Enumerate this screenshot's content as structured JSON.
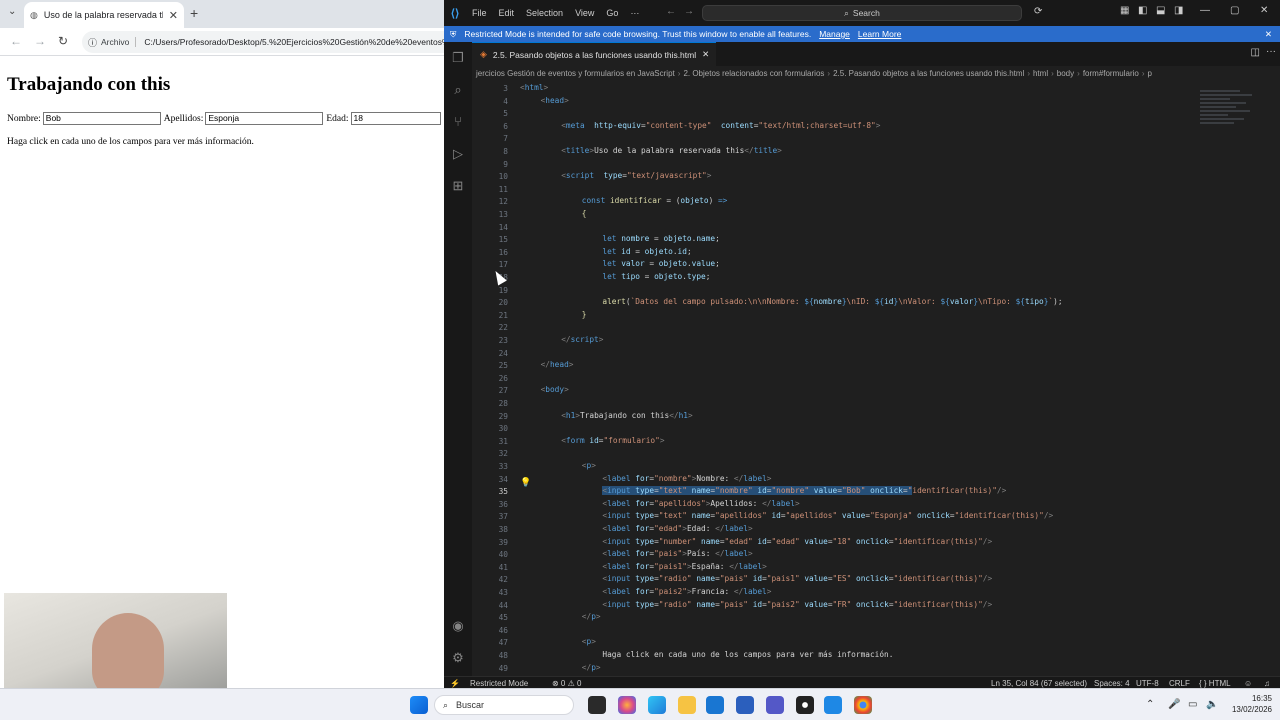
{
  "browser": {
    "tab_title": "Uso de la palabra reservada thi",
    "close": "✕",
    "new_tab": "+",
    "omnibox_chip": "Archivo",
    "url": "C:/Users/Profesorado/Desktop/5.%20Ejercicios%20Gestión%20de%20eventos%20y%20formularios",
    "page": {
      "heading": "Trabajando con this",
      "nombre_label": "Nombre:",
      "nombre_value": "Bob",
      "apellidos_label": "Apellidos:",
      "apellidos_value": "Esponja",
      "edad_label": "Edad:",
      "edad_value": "18",
      "info": "Haga click en cada uno de los campos para ver más información."
    }
  },
  "vscode": {
    "menu": [
      "File",
      "Edit",
      "Selection",
      "View",
      "Go",
      "···"
    ],
    "search_placeholder": "Search",
    "banner": {
      "text": "Restricted Mode is intended for safe code browsing. Trust this window to enable all features.",
      "manage": "Manage",
      "learn_more": "Learn More"
    },
    "active_tab": "2.5. Pasando objetos a las funciones usando this.html",
    "breadcrumb": [
      "jercicios Gestión de eventos y formularios en JavaScript",
      "2. Objetos relacionados con formularios",
      "2.5. Pasando objetos a las funciones usando this.html",
      "html",
      "body",
      "form#formulario",
      "p"
    ],
    "lines": [
      {
        "n": "3",
        "html": "<span class='tg'>&lt;</span><span class='tn'>html</span><span class='tg'>&gt;</span>",
        "indent": 0
      },
      {
        "n": "4",
        "html": "<span class='tg'>&lt;</span><span class='tn'>head</span><span class='tg'>&gt;</span>",
        "indent": 2
      },
      {
        "n": "5",
        "html": "",
        "indent": 0
      },
      {
        "n": "6",
        "html": "<span class='tg'>&lt;</span><span class='tn'>meta</span>  <span class='at'>http-equiv</span>=<span class='st'>\"content-type\"</span>  <span class='at'>content</span>=<span class='st'>\"text/html;charset=utf-8\"</span><span class='tg'>&gt;</span>",
        "indent": 4
      },
      {
        "n": "7",
        "html": "",
        "indent": 0
      },
      {
        "n": "8",
        "html": "<span class='tg'>&lt;</span><span class='tn'>title</span><span class='tg'>&gt;</span><span class='tx'>Uso de la palabra reservada this</span><span class='tg'>&lt;/</span><span class='tn'>title</span><span class='tg'>&gt;</span>",
        "indent": 4
      },
      {
        "n": "9",
        "html": "",
        "indent": 0
      },
      {
        "n": "10",
        "html": "<span class='tg'>&lt;</span><span class='tn'>script</span>  <span class='at'>type</span>=<span class='st'>\"text/javascript\"</span><span class='tg'>&gt;</span>",
        "indent": 4
      },
      {
        "n": "11",
        "html": "",
        "indent": 0
      },
      {
        "n": "12",
        "html": "<span class='kw'>const</span> <span class='fn'>identificar</span> = (<span class='at'>objeto</span>) <span class='kw'>=&gt;</span>",
        "indent": 6
      },
      {
        "n": "13",
        "html": "<span class='fn'>{</span>",
        "indent": 6
      },
      {
        "n": "14",
        "html": "",
        "indent": 0
      },
      {
        "n": "15",
        "html": "<span class='kw'>let</span> <span class='at'>nombre</span> = <span class='at'>objeto</span>.<span class='at'>name</span>;",
        "indent": 8
      },
      {
        "n": "16",
        "html": "<span class='kw'>let</span> <span class='at'>id</span> = <span class='at'>objeto</span>.<span class='at'>id</span>;",
        "indent": 8
      },
      {
        "n": "17",
        "html": "<span class='kw'>let</span> <span class='at'>valor</span> = <span class='at'>objeto</span>.<span class='at'>value</span>;",
        "indent": 8
      },
      {
        "n": "18",
        "html": "<span class='kw'>let</span> <span class='at'>tipo</span> = <span class='at'>objeto</span>.<span class='at'>type</span>;",
        "indent": 8
      },
      {
        "n": "19",
        "html": "",
        "indent": 0
      },
      {
        "n": "20",
        "html": "<span class='fn'>alert</span>(<span class='st'>`Datos del campo pulsado:\\n\\nNombre: </span><span class='kw'>${</span><span class='at'>nombre</span><span class='kw'>}</span><span class='st'>\\nID: </span><span class='kw'>${</span><span class='at'>id</span><span class='kw'>}</span><span class='st'>\\nValor: </span><span class='kw'>${</span><span class='at'>valor</span><span class='kw'>}</span><span class='st'>\\nTipo: </span><span class='kw'>${</span><span class='at'>tipo</span><span class='kw'>}</span><span class='st'>`</span>);",
        "indent": 8
      },
      {
        "n": "21",
        "html": "<span class='fn'>}</span>",
        "indent": 6
      },
      {
        "n": "22",
        "html": "",
        "indent": 0
      },
      {
        "n": "23",
        "html": "<span class='tg'>&lt;/</span><span class='tn'>script</span><span class='tg'>&gt;</span>",
        "indent": 4
      },
      {
        "n": "24",
        "html": "",
        "indent": 0
      },
      {
        "n": "25",
        "html": "<span class='tg'>&lt;/</span><span class='tn'>head</span><span class='tg'>&gt;</span>",
        "indent": 2
      },
      {
        "n": "26",
        "html": "",
        "indent": 0
      },
      {
        "n": "27",
        "html": "<span class='tg'>&lt;</span><span class='tn'>body</span><span class='tg'>&gt;</span>",
        "indent": 2
      },
      {
        "n": "28",
        "html": "",
        "indent": 0
      },
      {
        "n": "29",
        "html": "<span class='tg'>&lt;</span><span class='tn'>h1</span><span class='tg'>&gt;</span><span class='tx'>Trabajando con this</span><span class='tg'>&lt;/</span><span class='tn'>h1</span><span class='tg'>&gt;</span>",
        "indent": 4
      },
      {
        "n": "30",
        "html": "",
        "indent": 0
      },
      {
        "n": "31",
        "html": "<span class='tg'>&lt;</span><span class='tn'>form</span> <span class='at'>id</span>=<span class='st'>\"formulario\"</span><span class='tg'>&gt;</span>",
        "indent": 4
      },
      {
        "n": "32",
        "html": "",
        "indent": 0
      },
      {
        "n": "33",
        "html": "<span class='tg'>&lt;</span><span class='tn'>p</span><span class='tg'>&gt;</span>",
        "indent": 6
      },
      {
        "n": "34",
        "html": "<span class='tg'>&lt;</span><span class='tn'>label</span> <span class='at'>for</span>=<span class='st'>\"nombre\"</span><span class='tg'>&gt;</span><span class='tx'>Nombre: </span><span class='tg'>&lt;/</span><span class='tn'>label</span><span class='tg'>&gt;</span>",
        "indent": 8
      },
      {
        "n": "35",
        "html": "<span class='sel'><span class='tg'>&lt;</span><span class='tn'>input</span> <span class='at'>type</span>=<span class='st'>\"text\"</span> <span class='at'>name</span>=<span class='st'>\"nombre\"</span> <span class='at'>id</span>=<span class='st'>\"nombre\"</span> <span class='at'>value</span>=<span class='st'>\"Bob\"</span> <span class='at'>onclick</span>=<span class='st'>\"</span></span><span class='st'>identificar(this)\"</span><span class='tg'>/&gt;</span>",
        "indent": 8
      },
      {
        "n": "36",
        "html": "<span class='tg'>&lt;</span><span class='tn'>label</span> <span class='at'>for</span>=<span class='st'>\"apellidos\"</span><span class='tg'>&gt;</span><span class='tx'>Apellidos: </span><span class='tg'>&lt;/</span><span class='tn'>label</span><span class='tg'>&gt;</span>",
        "indent": 8
      },
      {
        "n": "37",
        "html": "<span class='tg'>&lt;</span><span class='tn'>input</span> <span class='at'>type</span>=<span class='st'>\"text\"</span> <span class='at'>name</span>=<span class='st'>\"apellidos\"</span> <span class='at'>id</span>=<span class='st'>\"apellidos\"</span> <span class='at'>value</span>=<span class='st'>\"Esponja\"</span> <span class='at'>onclick</span>=<span class='st'>\"identificar(this)\"</span><span class='tg'>/&gt;</span>",
        "indent": 8
      },
      {
        "n": "38",
        "html": "<span class='tg'>&lt;</span><span class='tn'>label</span> <span class='at'>for</span>=<span class='st'>\"edad\"</span><span class='tg'>&gt;</span><span class='tx'>Edad: </span><span class='tg'>&lt;/</span><span class='tn'>label</span><span class='tg'>&gt;</span>",
        "indent": 8
      },
      {
        "n": "39",
        "html": "<span class='tg'>&lt;</span><span class='tn'>input</span> <span class='at'>type</span>=<span class='st'>\"number\"</span> <span class='at'>name</span>=<span class='st'>\"edad\"</span> <span class='at'>id</span>=<span class='st'>\"edad\"</span> <span class='at'>value</span>=<span class='st'>\"18\"</span> <span class='at'>onclick</span>=<span class='st'>\"identificar(this)\"</span><span class='tg'>/&gt;</span>",
        "indent": 8
      },
      {
        "n": "40",
        "html": "<span class='tg'>&lt;</span><span class='tn'>label</span> <span class='at'>for</span>=<span class='st'>\"pais\"</span><span class='tg'>&gt;</span><span class='tx'>País: </span><span class='tg'>&lt;/</span><span class='tn'>label</span><span class='tg'>&gt;</span>",
        "indent": 8
      },
      {
        "n": "41",
        "html": "<span class='tg'>&lt;</span><span class='tn'>label</span> <span class='at'>for</span>=<span class='st'>\"pais1\"</span><span class='tg'>&gt;</span><span class='tx'>España: </span><span class='tg'>&lt;/</span><span class='tn'>label</span><span class='tg'>&gt;</span>",
        "indent": 8
      },
      {
        "n": "42",
        "html": "<span class='tg'>&lt;</span><span class='tn'>input</span> <span class='at'>type</span>=<span class='st'>\"radio\"</span> <span class='at'>name</span>=<span class='st'>\"pais\"</span> <span class='at'>id</span>=<span class='st'>\"pais1\"</span> <span class='at'>value</span>=<span class='st'>\"ES\"</span> <span class='at'>onclick</span>=<span class='st'>\"identificar(this)\"</span><span class='tg'>/&gt;</span>",
        "indent": 8
      },
      {
        "n": "43",
        "html": "<span class='tg'>&lt;</span><span class='tn'>label</span> <span class='at'>for</span>=<span class='st'>\"pais2\"</span><span class='tg'>&gt;</span><span class='tx'>Francia: </span><span class='tg'>&lt;/</span><span class='tn'>label</span><span class='tg'>&gt;</span>",
        "indent": 8
      },
      {
        "n": "44",
        "html": "<span class='tg'>&lt;</span><span class='tn'>input</span> <span class='at'>type</span>=<span class='st'>\"radio\"</span> <span class='at'>name</span>=<span class='st'>\"pais\"</span> <span class='at'>id</span>=<span class='st'>\"pais2\"</span> <span class='at'>value</span>=<span class='st'>\"FR\"</span> <span class='at'>onclick</span>=<span class='st'>\"identificar(this)\"</span><span class='tg'>/&gt;</span>",
        "indent": 8
      },
      {
        "n": "45",
        "html": "<span class='tg'>&lt;/</span><span class='tn'>p</span><span class='tg'>&gt;</span>",
        "indent": 6
      },
      {
        "n": "46",
        "html": "",
        "indent": 0
      },
      {
        "n": "47",
        "html": "<span class='tg'>&lt;</span><span class='tn'>p</span><span class='tg'>&gt;</span>",
        "indent": 6
      },
      {
        "n": "48",
        "html": "<span class='tx'>Haga click en cada uno de los campos para ver más información.</span>",
        "indent": 8
      },
      {
        "n": "49",
        "html": "<span class='tg'>&lt;/</span><span class='tn'>p</span><span class='tg'>&gt;</span>",
        "indent": 6
      }
    ],
    "current_line": "35",
    "status": {
      "remote": "⚡",
      "restricted": "Restricted Mode",
      "problems": "⊗ 0  ⚠ 0",
      "position": "Ln 35, Col 84 (67 selected)",
      "spaces": "Spaces: 4",
      "encoding": "UTF-8",
      "eol": "CRLF",
      "language": "{ } HTML"
    }
  },
  "taskbar": {
    "search": "Buscar",
    "time": "16:35",
    "date": "13/02/2026"
  }
}
